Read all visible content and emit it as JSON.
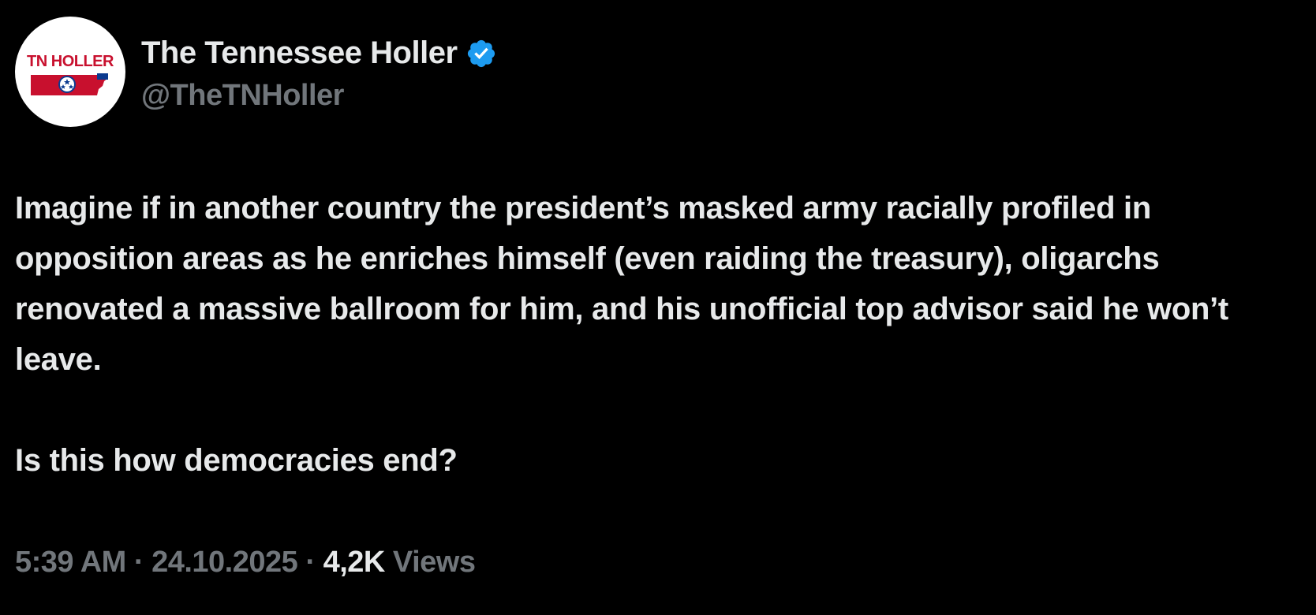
{
  "author": {
    "display_name": "The Tennessee Holler",
    "handle": "@TheTNHoller",
    "verified": true,
    "avatar_logo_text": "TN HOLLER"
  },
  "tweet": {
    "paragraphs": [
      "Imagine if in another country the president’s masked army racially profiled in opposition areas as he enriches himself (even raiding the treasury), oligarchs renovated a massive ballroom for him, and his unofficial top advisor said he won’t leave.",
      "Is this how democracies end?"
    ],
    "time": "5:39 AM",
    "separator": "·",
    "date": "24.10.2025",
    "views_count": "4,2K",
    "views_label": "Views"
  },
  "colors": {
    "background": "#000000",
    "text_primary": "#e7e9ea",
    "text_secondary": "#71767b",
    "verified_blue": "#1d9bf0",
    "logo_red": "#c8102e",
    "logo_blue": "#0b3a8f"
  }
}
